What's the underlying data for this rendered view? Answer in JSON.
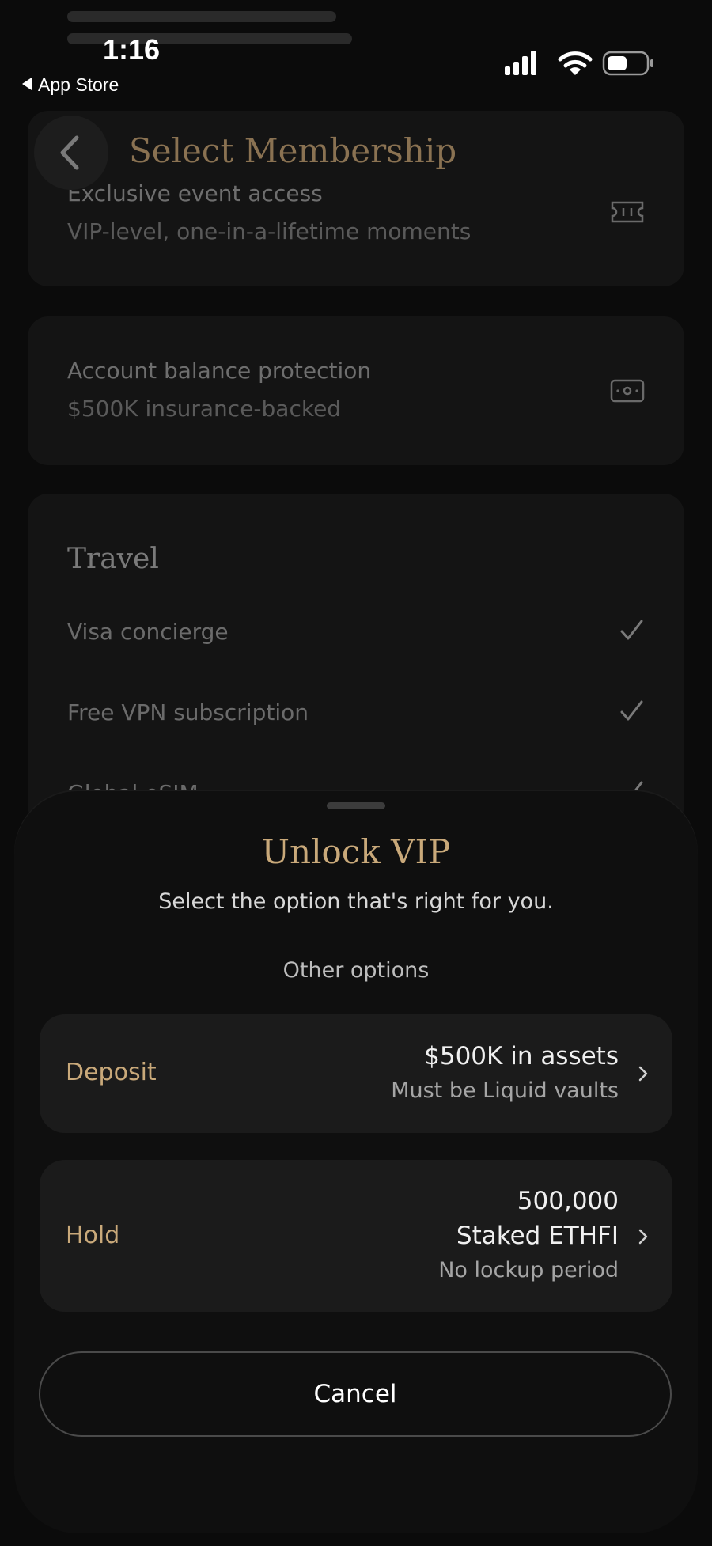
{
  "status_bar": {
    "time": "1:16",
    "back_app": "App Store"
  },
  "header": {
    "title": "Select Membership"
  },
  "background": {
    "cards": [
      {
        "title": "Exclusive event access",
        "subtitle": "VIP-level, one-in-a-lifetime moments",
        "icon": "ticket-icon"
      },
      {
        "title": "Account balance protection",
        "subtitle": "$500K insurance-backed",
        "icon": "cash-icon"
      }
    ],
    "travel": {
      "title": "Travel",
      "items": [
        "Visa concierge",
        "Free VPN subscription",
        "Global eSIM"
      ]
    }
  },
  "sheet": {
    "title": "Unlock VIP",
    "subtitle": "Select the option that's right for you.",
    "other_options": "Other options",
    "options": [
      {
        "label": "Deposit",
        "lines": [
          "$500K in assets"
        ],
        "note": "Must be Liquid vaults"
      },
      {
        "label": "Hold",
        "lines": [
          "500,000",
          "Staked ETHFI"
        ],
        "note": "No lockup period"
      }
    ],
    "cancel_label": "Cancel"
  },
  "colors": {
    "accent_gold": "#c9a97a",
    "title_gold_dim": "#8a7252",
    "sheet_bg": "#0f0f0f",
    "option_bg": "#1b1b1b"
  }
}
